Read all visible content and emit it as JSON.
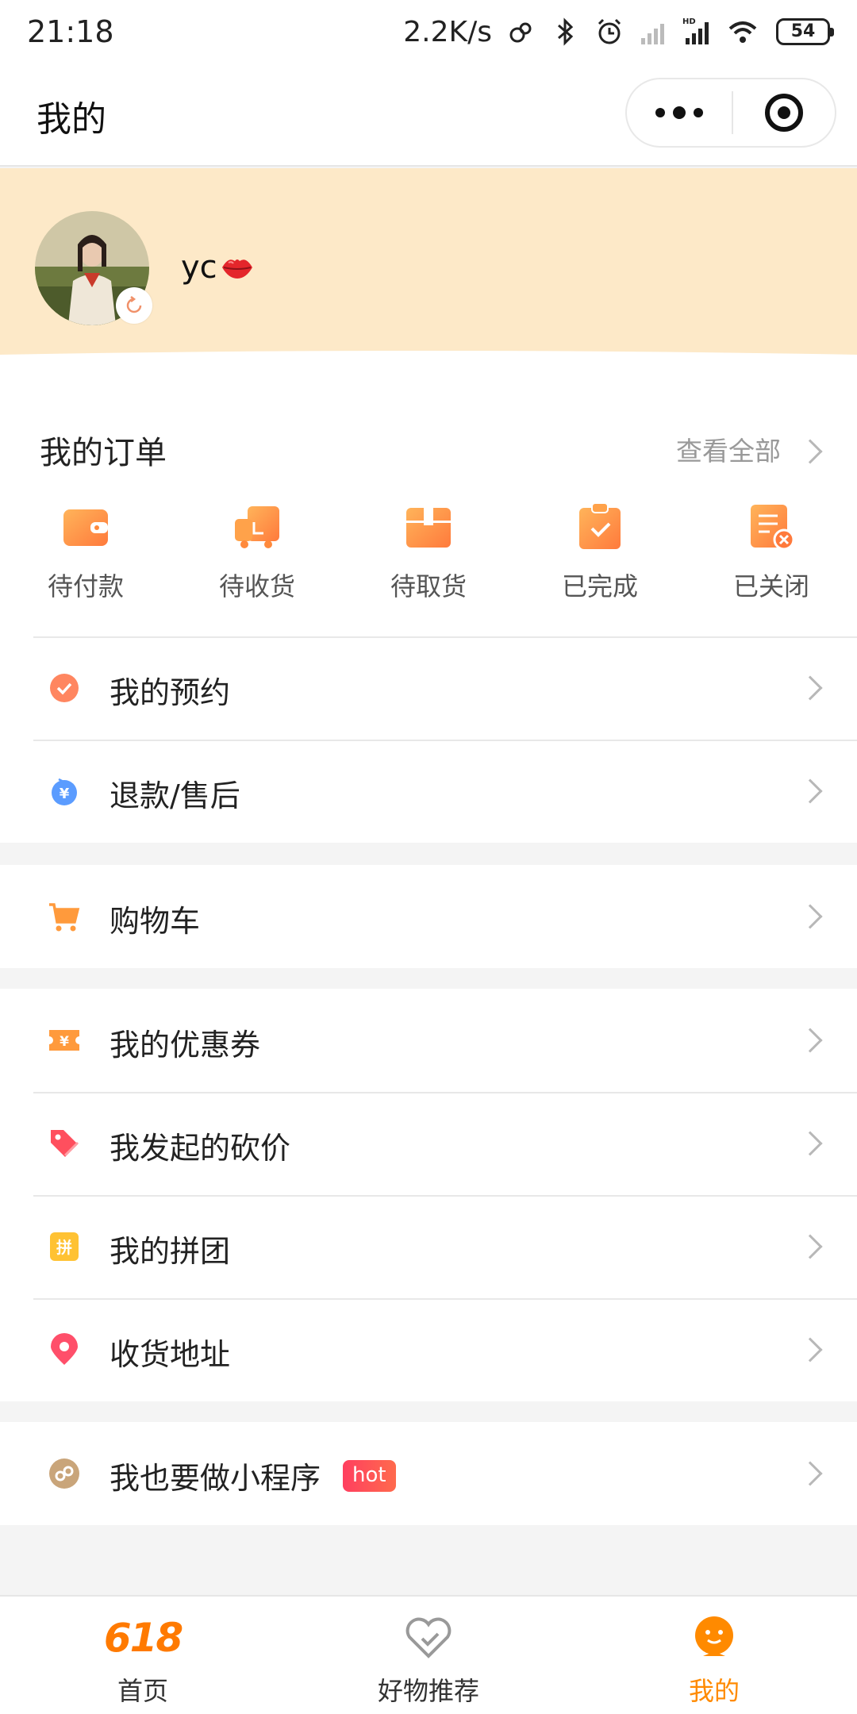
{
  "status_bar": {
    "time": "21:18",
    "network_speed": "2.2K/s",
    "battery": "54",
    "network_type": "HD"
  },
  "nav": {
    "title": "我的"
  },
  "profile": {
    "username": "yc",
    "header_color": "#fde9c8"
  },
  "orders": {
    "title": "我的订单",
    "view_all": "查看全部",
    "items": [
      {
        "label": "待付款",
        "icon": "wallet-icon"
      },
      {
        "label": "待收货",
        "icon": "truck-icon"
      },
      {
        "label": "待取货",
        "icon": "box-icon"
      },
      {
        "label": "已完成",
        "icon": "clipboard-check-icon"
      },
      {
        "label": "已关闭",
        "icon": "document-close-icon"
      }
    ]
  },
  "menu": {
    "reservation": "我的预约",
    "refund": "退款/售后",
    "cart": "购物车",
    "coupons": "我的优惠券",
    "bargain": "我发起的砍价",
    "group_buy": "我的拼团",
    "address": "收货地址",
    "mini_program": "我也要做小程序",
    "hot_badge": "hot"
  },
  "tabbar": {
    "home_logo": "618",
    "home": "首页",
    "recommend": "好物推荐",
    "mine": "我的"
  },
  "colors": {
    "accent": "#ff8a00",
    "icon_orange": "#ff9a3c"
  }
}
